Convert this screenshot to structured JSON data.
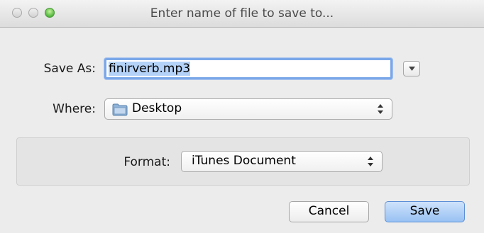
{
  "window": {
    "title": "Enter name of file to save to..."
  },
  "save_as": {
    "label": "Save As:",
    "value": "finirverb.mp3"
  },
  "where": {
    "label": "Where:",
    "value": "Desktop",
    "icon": "folder-icon"
  },
  "format": {
    "label": "Format:",
    "value": "iTunes Document"
  },
  "buttons": {
    "cancel": "Cancel",
    "save": "Save"
  },
  "colors": {
    "focus_ring": "#7aa7e8",
    "selection": "#b4d2f8",
    "default_button": "#98c1f3",
    "zoom_light": "#61c04a"
  }
}
